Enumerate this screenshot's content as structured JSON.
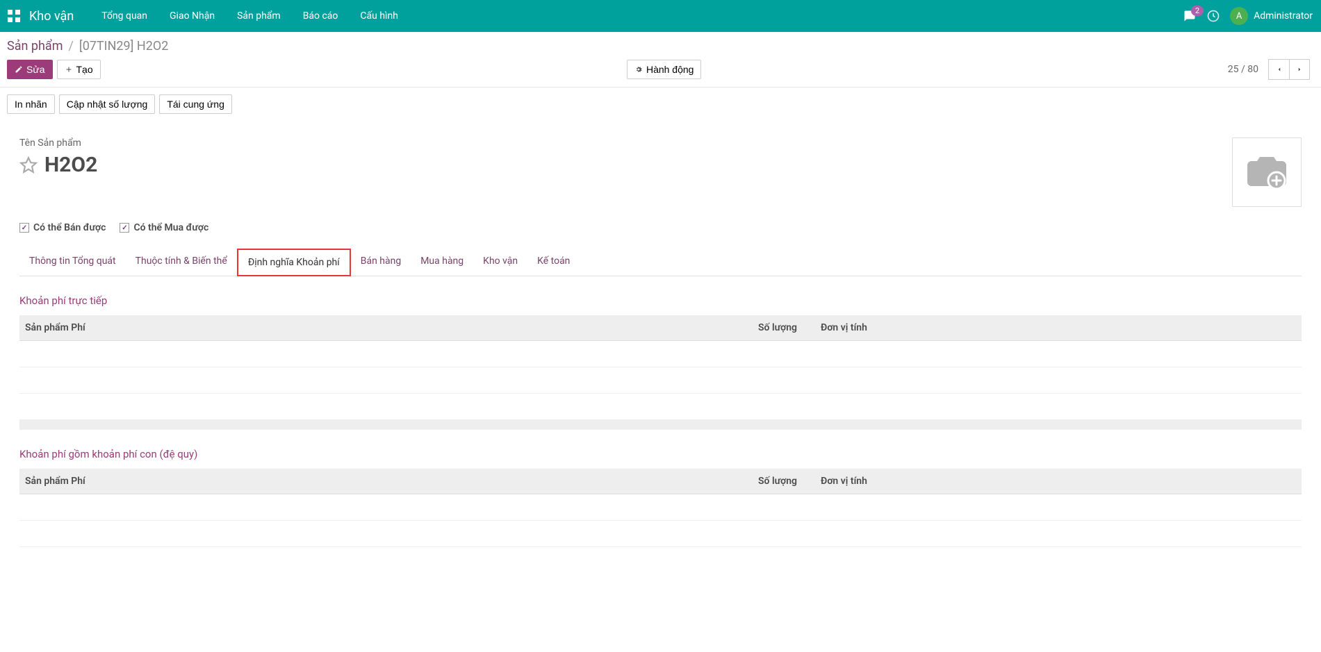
{
  "navbar": {
    "title": "Kho vận",
    "menu": [
      "Tổng quan",
      "Giao Nhận",
      "Sản phẩm",
      "Báo cáo",
      "Cấu hình"
    ],
    "badge_count": "2",
    "user_initial": "A",
    "user_name": "Administrator"
  },
  "breadcrumb": {
    "root": "Sản phẩm",
    "current": "[07TIN29] H2O2"
  },
  "buttons": {
    "edit": "Sửa",
    "create": "Tạo",
    "action": "Hành động",
    "print_label": "In nhãn",
    "update_qty": "Cập nhật số lượng",
    "replenish": "Tái cung ứng"
  },
  "pager": {
    "text": "25 / 80"
  },
  "form": {
    "name_label": "Tên Sản phẩm",
    "product_name": "H2O2",
    "can_sell": "Có thể Bán được",
    "can_buy": "Có thể Mua được"
  },
  "tabs": [
    "Thông tin Tổng quát",
    "Thuộc tính & Biến thể",
    "Định nghĩa Khoản phí",
    "Bán hàng",
    "Mua hàng",
    "Kho vận",
    "Kế toán"
  ],
  "active_tab_index": 2,
  "sections": {
    "direct": {
      "title": "Khoản phí trực tiếp",
      "columns": {
        "product": "Sản phẩm Phí",
        "qty": "Số lượng",
        "uom": "Đơn vị tính"
      }
    },
    "recursive": {
      "title": "Khoản phí gồm khoản phí con (đệ quy)",
      "columns": {
        "product": "Sản phẩm Phí",
        "qty": "Số lượng",
        "uom": "Đơn vị tính"
      }
    }
  }
}
